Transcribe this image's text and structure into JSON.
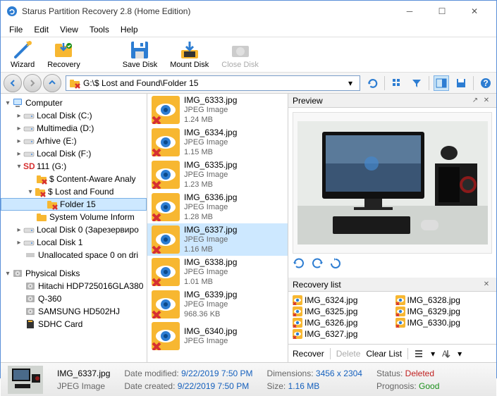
{
  "window": {
    "title": "Starus Partition Recovery 2.8 (Home Edition)"
  },
  "menu": {
    "file": "File",
    "edit": "Edit",
    "view": "View",
    "tools": "Tools",
    "help": "Help"
  },
  "toolbar": {
    "wizard": "Wizard",
    "recovery": "Recovery",
    "savedisk": "Save Disk",
    "mountdisk": "Mount Disk",
    "closedisk": "Close Disk"
  },
  "address": {
    "path": "G:\\$ Lost and Found\\Folder 15"
  },
  "tree": {
    "computer": "Computer",
    "localc": "Local Disk (C:)",
    "multimedia": "Multimedia (D:)",
    "arhive": "Arhive (E:)",
    "localf": "Local Disk (F:)",
    "g111": "111 (G:)",
    "contentaware": "$ Content-Aware Analy",
    "lostfound": "$ Lost and Found",
    "folder15": "Folder 15",
    "sysvol": "System Volume Inform",
    "localdisk0": "Local Disk 0 (Зарезервиро",
    "localdisk1": "Local Disk 1",
    "unalloc": "Unallocated space 0 on dri",
    "physical": "Physical Disks",
    "hitachi": "Hitachi HDP725016GLA380",
    "q360": "Q-360",
    "samsung": "SAMSUNG HD502HJ",
    "sdhc": "SDHC Card"
  },
  "files": [
    {
      "name": "IMG_6333.jpg",
      "type": "JPEG Image",
      "size": "1.24 MB"
    },
    {
      "name": "IMG_6334.jpg",
      "type": "JPEG Image",
      "size": "1.15 MB"
    },
    {
      "name": "IMG_6335.jpg",
      "type": "JPEG Image",
      "size": "1.23 MB"
    },
    {
      "name": "IMG_6336.jpg",
      "type": "JPEG Image",
      "size": "1.28 MB"
    },
    {
      "name": "IMG_6337.jpg",
      "type": "JPEG Image",
      "size": "1.16 MB"
    },
    {
      "name": "IMG_6338.jpg",
      "type": "JPEG Image",
      "size": "1.01 MB"
    },
    {
      "name": "IMG_6339.jpg",
      "type": "JPEG Image",
      "size": "968.36 KB"
    },
    {
      "name": "IMG_6340.jpg",
      "type": "JPEG Image",
      "size": ""
    }
  ],
  "preview": {
    "title": "Preview"
  },
  "recoverylist": {
    "title": "Recovery list",
    "items": [
      "IMG_6324.jpg",
      "IMG_6328.jpg",
      "IMG_6325.jpg",
      "IMG_6329.jpg",
      "IMG_6326.jpg",
      "IMG_6330.jpg",
      "IMG_6327.jpg"
    ],
    "recover": "Recover",
    "delete": "Delete",
    "clear": "Clear List"
  },
  "status": {
    "filename": "IMG_6337.jpg",
    "filetype": "JPEG Image",
    "modlabel": "Date modified:",
    "modval": "9/22/2019 7:50 PM",
    "crlabel": "Date created:",
    "crval": "9/22/2019 7:50 PM",
    "dimlabel": "Dimensions:",
    "dimval": "3456 x 2304",
    "sizelabel": "Size:",
    "sizeval": "1.16 MB",
    "statuslabel": "Status:",
    "statusval": "Deleted",
    "proglabel": "Prognosis:",
    "progval": "Good"
  }
}
